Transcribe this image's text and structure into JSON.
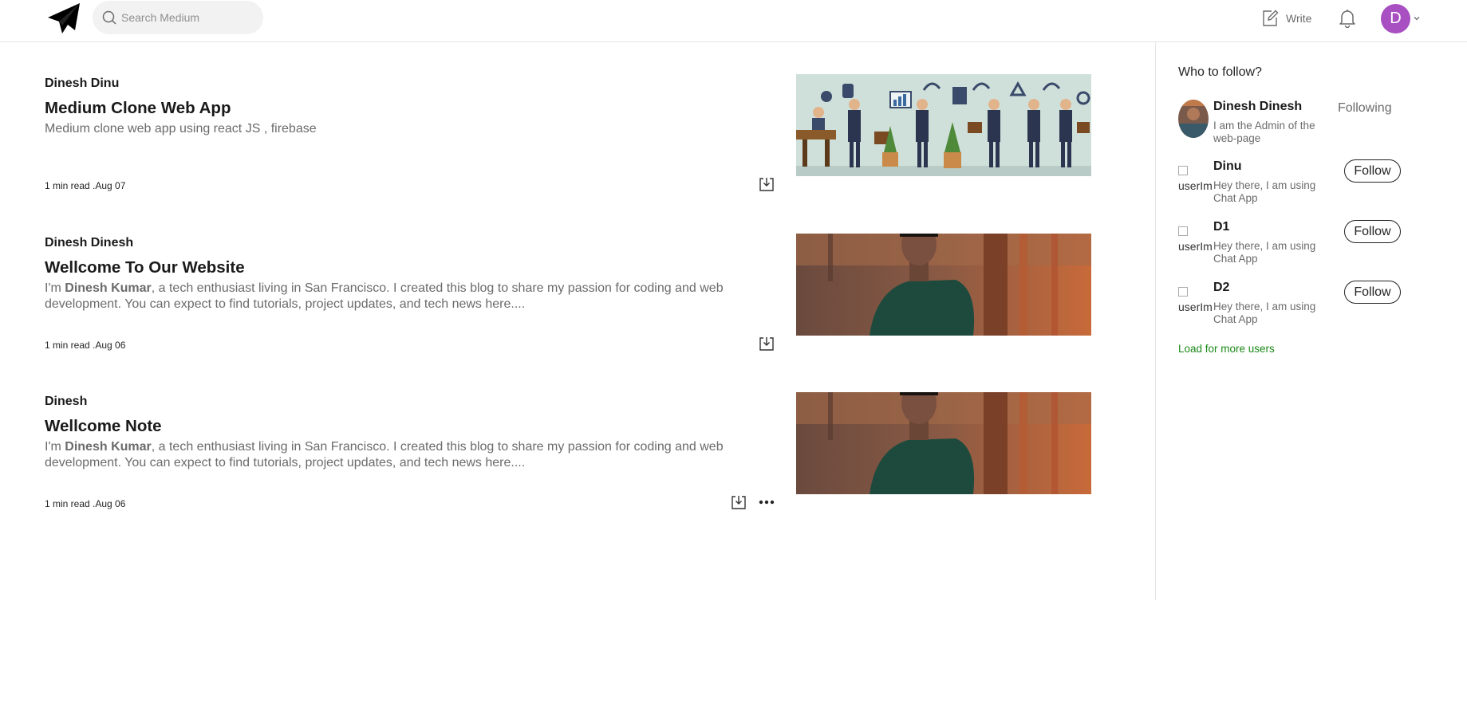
{
  "header": {
    "search_placeholder": "Search Medium",
    "write_label": "Write",
    "avatar_initial": "D"
  },
  "posts": [
    {
      "author": "Dinesh Dinu",
      "title": "Medium Clone Web App",
      "excerpt_plain": "Medium clone web app using react JS , firebase",
      "meta": "1 min read .Aug 07"
    },
    {
      "author": "Dinesh Dinesh",
      "title": "Wellcome To Our Website",
      "excerpt_prefix": "I'm ",
      "excerpt_bold": "Dinesh Kumar",
      "excerpt_suffix": ", a tech enthusiast living in San Francisco. I created this blog to share my passion for coding and web development. You can expect to find tutorials, project updates, and tech news here....",
      "meta": "1 min read .Aug 06"
    },
    {
      "author": "Dinesh",
      "title": "Wellcome Note",
      "excerpt_prefix": "I'm ",
      "excerpt_bold": "Dinesh Kumar",
      "excerpt_suffix": ", a tech enthusiast living in San Francisco. I created this blog to share my passion for coding and web development. You can expect to find tutorials, project updates, and tech news here....",
      "meta": "1 min read .Aug 06"
    }
  ],
  "sidebar": {
    "heading": "Who to follow?",
    "users": [
      {
        "name": "Dinesh Dinesh",
        "bio": "I am the Admin of the web-page",
        "action": "Following"
      },
      {
        "name": "Dinu",
        "bio": "Hey there, I am using Chat App",
        "action": "Follow",
        "img_alt": "userIm"
      },
      {
        "name": "D1",
        "bio": "Hey there, I am using Chat App",
        "action": "Follow",
        "img_alt": "userIm"
      },
      {
        "name": "D2",
        "bio": "Hey there, I am using Chat App",
        "action": "Follow",
        "img_alt": "userIm"
      }
    ],
    "load_more": "Load for more users"
  },
  "colors": {
    "avatar_bg": "#a84fc2",
    "link_green": "#1a8917",
    "muted_text": "#6b6b6b"
  }
}
